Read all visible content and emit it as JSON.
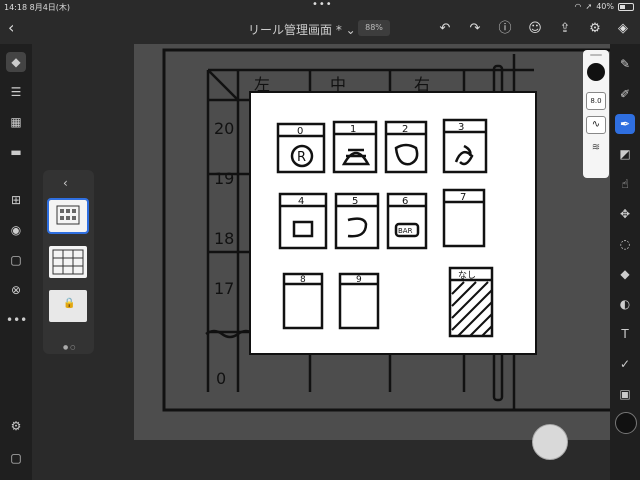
{
  "status": {
    "time": "14:18",
    "date": "8月4日(木)",
    "battery": "40%",
    "battery_level": 0.4,
    "dots": "•••"
  },
  "header": {
    "title": "リール管理画面 *",
    "zoom": "88%",
    "icons": [
      "back-icon",
      "undo-icon",
      "redo-icon",
      "help-icon",
      "share-user-icon",
      "export-icon",
      "settings-icon",
      "layers-stack-icon"
    ]
  },
  "left_toolbar": [
    "layers-icon",
    "adjust-icon",
    "grid-icon",
    "comment-icon",
    "add-layer-icon",
    "visibility-icon",
    "mask-icon",
    "blend-icon",
    "more-icon",
    "properties-icon",
    "frame-icon"
  ],
  "layers_panel": {
    "pages": 2,
    "current_page": 1
  },
  "brush_panel": {
    "size": "8.0",
    "color": "#111111"
  },
  "right_toolbar": [
    "brush-icon",
    "pixel-brush-icon",
    "vector-brush-icon",
    "eraser-icon",
    "smudge-icon",
    "move-icon",
    "lasso-icon",
    "fill-icon",
    "liquify-icon",
    "text-icon",
    "eyedropper-icon",
    "image-icon"
  ],
  "canvas": {
    "header_cells": [
      "左",
      "中",
      "右"
    ],
    "row_labels": [
      "20",
      "19",
      "18",
      "17",
      "0"
    ],
    "symbol_numbers": [
      "0",
      "1",
      "2",
      "3",
      "4",
      "5",
      "6",
      "7",
      "8",
      "9",
      "なし"
    ],
    "overlay_labels": [
      "R",
      "BAR"
    ]
  },
  "colors": {
    "accent": "#2f6fe0",
    "bg": "#2a2a2a",
    "paper": "#ffffff"
  }
}
